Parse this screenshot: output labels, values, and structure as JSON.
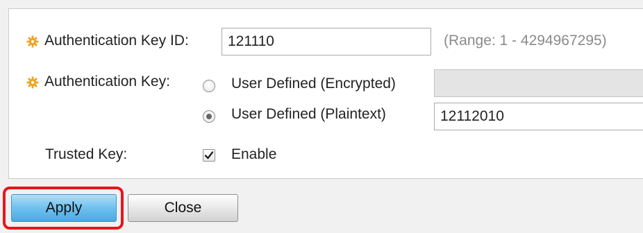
{
  "form": {
    "key_id": {
      "label": "Authentication Key ID:",
      "value": "121110",
      "hint": "(Range: 1 - 4294967295)",
      "required": true
    },
    "auth_key": {
      "label": "Authentication Key:",
      "required": true,
      "options": [
        {
          "label": "User Defined (Encrypted)",
          "checked": false,
          "value": "",
          "disabled": true
        },
        {
          "label": "User Defined (Plaintext)",
          "checked": true,
          "value": "12112010",
          "disabled": false
        }
      ]
    },
    "trusted_key": {
      "label": "Trusted Key:",
      "checkbox_label": "Enable",
      "checked": true
    }
  },
  "buttons": {
    "apply": "Apply",
    "close": "Close"
  },
  "colors": {
    "required_icon": "#f0a321",
    "highlight": "#e8141c",
    "apply_button": "#6fc0ee"
  },
  "icons": {
    "required": "gear-icon",
    "check": "checkmark-icon"
  }
}
